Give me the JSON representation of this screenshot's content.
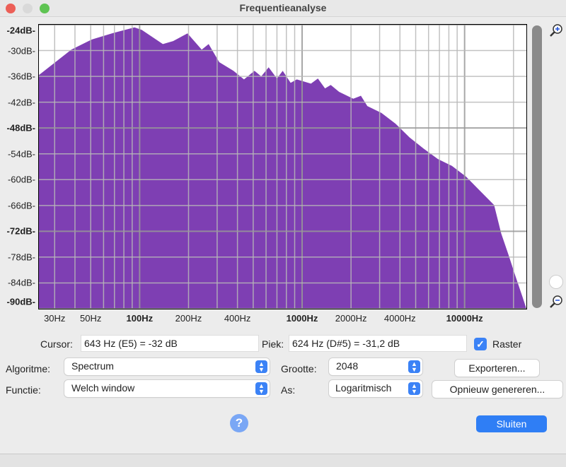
{
  "window": {
    "title": "Frequentieanalyse"
  },
  "chart_data": {
    "type": "area",
    "title": "",
    "xlabel": "",
    "ylabel": "",
    "xscale": "log",
    "xlim": [
      24,
      24000
    ],
    "ylim": [
      -90,
      -24
    ],
    "grid": true,
    "color": "#7e3fb3",
    "yticks": [
      {
        "v": -24,
        "label": "-24dB",
        "bold": true
      },
      {
        "v": -30,
        "label": "-30dB"
      },
      {
        "v": -36,
        "label": "-36dB"
      },
      {
        "v": -42,
        "label": "-42dB"
      },
      {
        "v": -48,
        "label": "-48dB",
        "bold": true
      },
      {
        "v": -54,
        "label": "-54dB"
      },
      {
        "v": -60,
        "label": "-60dB"
      },
      {
        "v": -66,
        "label": "-66dB"
      },
      {
        "v": -72,
        "label": "-72dB",
        "bold": true
      },
      {
        "v": -78,
        "label": "-78dB"
      },
      {
        "v": -84,
        "label": "-84dB"
      },
      {
        "v": -90,
        "label": "-90dB",
        "bold": true
      }
    ],
    "xticks": [
      {
        "v": 30,
        "label": "30Hz"
      },
      {
        "v": 50,
        "label": "50Hz"
      },
      {
        "v": 100,
        "label": "100Hz",
        "bold": true
      },
      {
        "v": 200,
        "label": "200Hz"
      },
      {
        "v": 400,
        "label": "400Hz"
      },
      {
        "v": 1000,
        "label": "1000Hz",
        "bold": true
      },
      {
        "v": 2000,
        "label": "2000Hz"
      },
      {
        "v": 4000,
        "label": "4000Hz"
      },
      {
        "v": 10000,
        "label": "10000Hz",
        "bold": true
      }
    ],
    "x": [
      24,
      38,
      51,
      69,
      93,
      103,
      139,
      161,
      197,
      241,
      266,
      309,
      378,
      439,
      509,
      560,
      622,
      700,
      760,
      850,
      927,
      1133,
      1250,
      1384,
      1500,
      1690,
      2064,
      2300,
      2520,
      3078,
      3758,
      4590,
      5600,
      6840,
      8350,
      10200,
      12450,
      15200,
      16800,
      18600,
      20500,
      22700,
      24000
    ],
    "y": [
      -35.7,
      -29.8,
      -27.4,
      -25.9,
      -24.6,
      -25.2,
      -28.5,
      -27.8,
      -26.0,
      -29.8,
      -28.5,
      -32.7,
      -34.7,
      -36.7,
      -34.7,
      -36,
      -33.9,
      -36.5,
      -34.7,
      -37.5,
      -36.7,
      -37.7,
      -36.5,
      -38.8,
      -38,
      -39.6,
      -41.2,
      -40.5,
      -42.9,
      -44.5,
      -47.0,
      -50.2,
      -52.8,
      -55.2,
      -56.8,
      -59.3,
      -62.6,
      -65.9,
      -72.5,
      -77.4,
      -82.3,
      -87.2,
      -90
    ]
  },
  "controls": {
    "cursor_label": "Cursor:",
    "cursor_value": "643 Hz (E5) = -32 dB",
    "peak_label": "Piek:",
    "peak_value": "624 Hz (D#5) = -31,2 dB",
    "grid_label": "Raster",
    "grid_checked": true,
    "algorithm_label": "Algoritme:",
    "algorithm_value": "Spectrum",
    "size_label": "Grootte:",
    "size_value": "2048",
    "function_label": "Functie:",
    "function_value": "Welch window",
    "axis_label": "As:",
    "axis_value": "Logaritmisch",
    "export_button": "Exporteren...",
    "regenerate_button": "Opnieuw genereren...",
    "help_button": "?",
    "close_button": "Sluiten"
  }
}
